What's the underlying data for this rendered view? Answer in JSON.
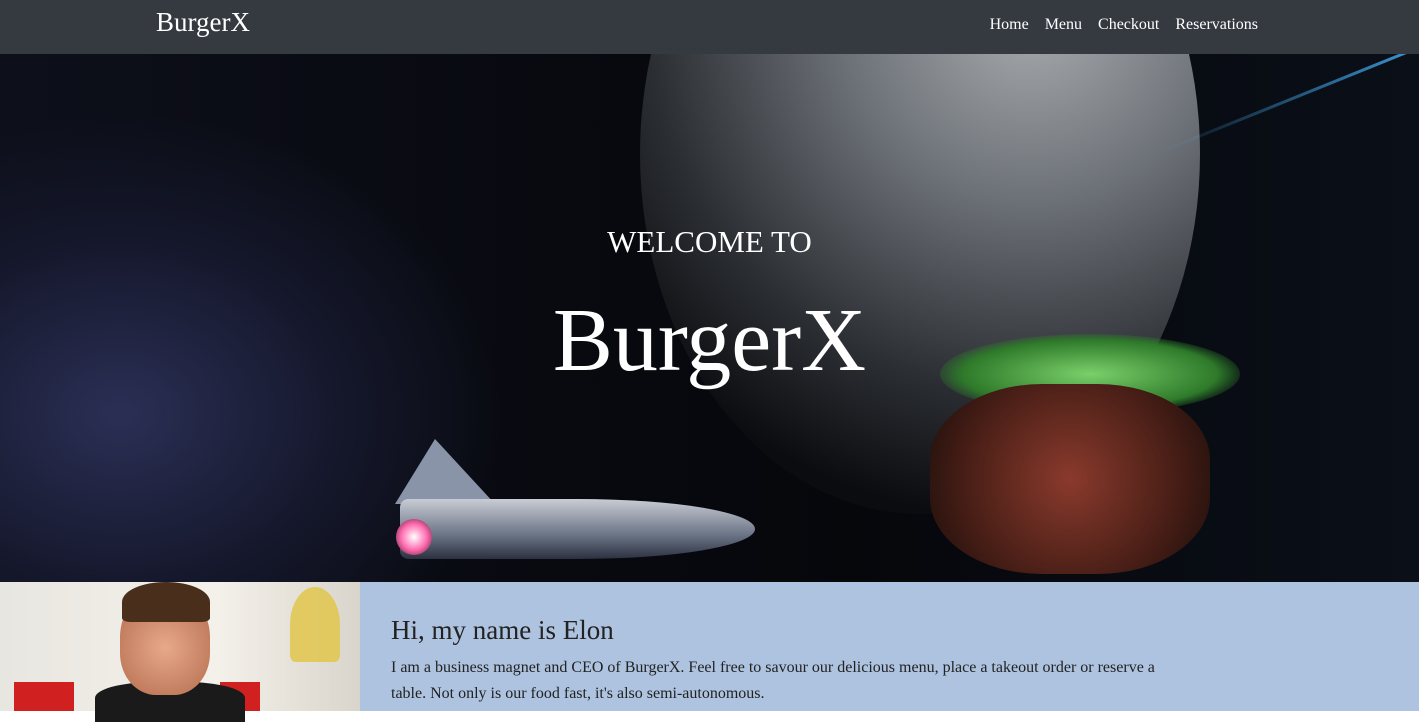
{
  "navbar": {
    "brand": "BurgerX",
    "links": [
      "Home",
      "Menu",
      "Checkout",
      "Reservations"
    ]
  },
  "hero": {
    "welcome": "WELCOME TO",
    "title": "BurgerX"
  },
  "bio": {
    "heading": "Hi, my name is Elon",
    "text": "I am a business magnet and CEO of BurgerX. Feel free to savour our delicious menu, place a takeout order or reserve a table. Not only is our food fast, it's also semi-autonomous."
  }
}
